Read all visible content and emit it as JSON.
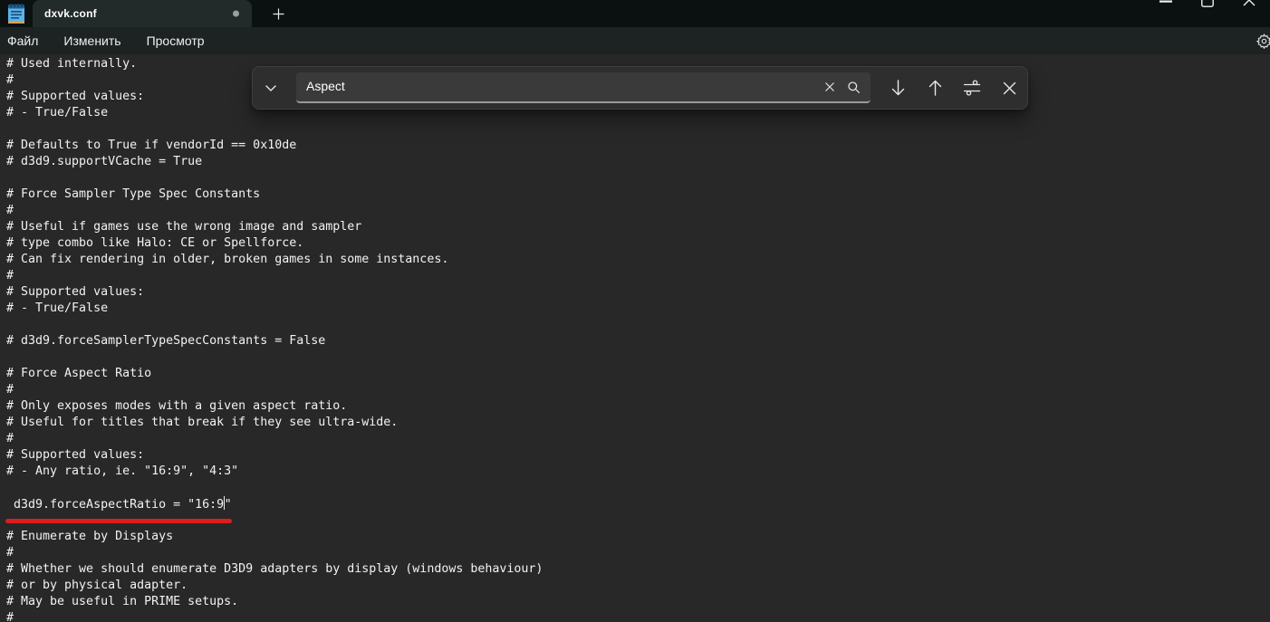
{
  "window": {
    "tab_title": "dxvk.conf",
    "tab_unsaved_indicator": true,
    "controls": [
      "minimize-icon",
      "maximize-icon",
      "close-icon"
    ]
  },
  "menu": {
    "items": [
      {
        "label": "Файл"
      },
      {
        "label": "Изменить"
      },
      {
        "label": "Просмотр"
      }
    ],
    "settings_icon": "gear-icon"
  },
  "find_bar": {
    "expand_icon": "chevron-down-icon",
    "value": "Aspect",
    "placeholder": "",
    "input_icons": [
      "clear-x-icon",
      "search-icon"
    ],
    "action_icons": [
      "find-next-down-icon",
      "find-previous-up-icon",
      "search-options-icon",
      "close-icon"
    ]
  },
  "document": {
    "lines": [
      "# Used internally.",
      "#",
      "# Supported values:",
      "# - True/False",
      "",
      "# Defaults to True if vendorId == 0x10de",
      "# d3d9.supportVCache = True",
      "",
      "# Force Sampler Type Spec Constants",
      "#",
      "# Useful if games use the wrong image and sampler",
      "# type combo like Halo: CE or Spellforce.",
      "# Can fix rendering in older, broken games in some instances.",
      "#",
      "# Supported values:",
      "# - True/False",
      "",
      "# d3d9.forceSamplerTypeSpecConstants = False",
      "",
      "# Force Aspect Ratio",
      "#",
      "# Only exposes modes with a given aspect ratio.",
      "# Useful for titles that break if they see ultra-wide.",
      "#",
      "# Supported values:",
      "# - Any ratio, ie. \"16:9\", \"4:3\"",
      "",
      " d3d9.forceAspectRatio = \"16:9\"",
      "",
      "# Enumerate by Displays",
      "#",
      "# Whether we should enumerate D3D9 adapters by display (windows behaviour)",
      "# or by physical adapter.",
      "# May be useful in PRIME setups.",
      "#"
    ],
    "caret": {
      "line_index": 27,
      "char_index": 30
    }
  },
  "annotation": {
    "type": "red-underline",
    "color": "#dd1d1d"
  },
  "colors": {
    "titlebar_bg": "#0b1111",
    "tab_bg": "#232a2a",
    "menubar_bg": "#1d2222",
    "editor_bg": "#282828",
    "text": "#f2f2f2",
    "findbar_bg": "#2e2e2e",
    "input_bg": "#3a3a3a",
    "input_underline": "#9a9a9a"
  }
}
